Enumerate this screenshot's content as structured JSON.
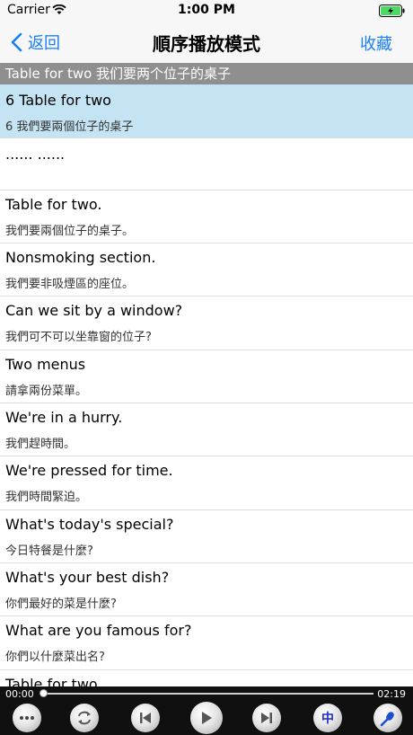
{
  "status_bar": {
    "carrier": "Carrier",
    "time": "1:00 PM"
  },
  "nav": {
    "back_label": "返回",
    "title": "順序播放模式",
    "favorite_label": "收藏"
  },
  "section_header": "Table for two 我们要两个位子的桌子",
  "rows": [
    {
      "en": "6 Table for two",
      "zh": "6 我們要兩個位子的桌子"
    },
    {
      "en": "...... ......",
      "zh": ""
    },
    {
      "en": "Table for two.",
      "zh": "我們要兩個位子的桌子。"
    },
    {
      "en": "Nonsmoking section.",
      "zh": "我們要非吸煙區的座位。"
    },
    {
      "en": "Can we sit by a window?",
      "zh": "我們可不可以坐靠窗的位子?"
    },
    {
      "en": "Two menus",
      "zh": "請拿兩份菜單。"
    },
    {
      "en": "We're in a hurry.",
      "zh": "我們趕時間。"
    },
    {
      "en": "We're pressed for time.",
      "zh": "我們時間緊迫。"
    },
    {
      "en": "What's today's special?",
      "zh": "今日特餐是什麼?"
    },
    {
      "en": "What's your best dish?",
      "zh": "你們最好的菜是什麼?"
    },
    {
      "en": "What are you famous for?",
      "zh": "你們以什麼菜出名?"
    },
    {
      "en": "Table for two",
      "zh": ""
    }
  ],
  "player": {
    "current_time": "00:00",
    "total_time": "02:19",
    "progress": 0.0,
    "language_button_label": "中"
  },
  "colors": {
    "accent": "#1a7ef7",
    "selected_row": "#c5e4f3",
    "section_header": "#8f8f8f",
    "player_bg": "#101010",
    "battery": "#4cd964"
  },
  "icons": [
    "wifi-icon",
    "battery-charging-icon",
    "chevron-left-icon",
    "more-icon",
    "repeat-icon",
    "previous-icon",
    "play-icon",
    "next-icon",
    "microphone-icon"
  ]
}
